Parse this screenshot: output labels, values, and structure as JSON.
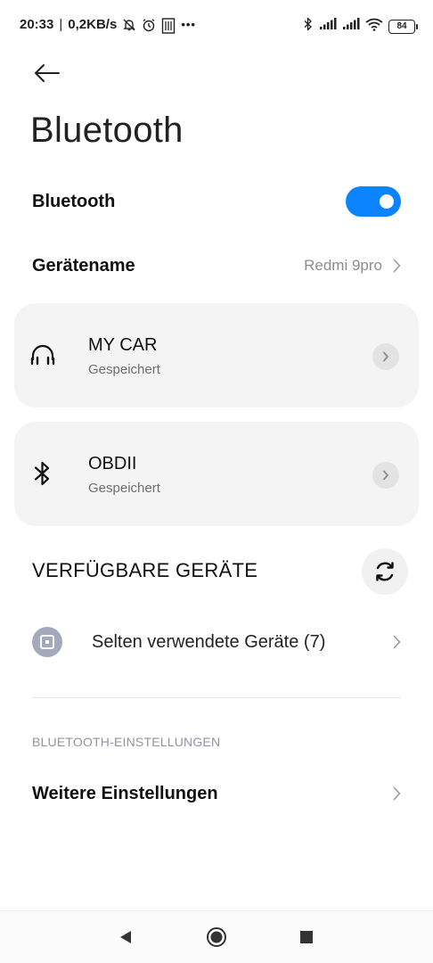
{
  "status_bar": {
    "time": "20:33",
    "separator": "|",
    "speed": "0,2KB/s",
    "more": "•••",
    "battery": "84",
    "icons_left": [
      "bell-off-icon",
      "alarm-icon",
      "sim-icon"
    ],
    "icons_right": [
      "bluetooth-icon",
      "signal-icon",
      "signal-icon",
      "wifi-icon",
      "battery-icon"
    ]
  },
  "header": {
    "title": "Bluetooth",
    "back_icon": "arrow-left-icon"
  },
  "bluetooth_row": {
    "label": "Bluetooth",
    "enabled": true,
    "accent_color": "#0d84ff"
  },
  "device_name_row": {
    "label": "Gerätename",
    "value": "Redmi 9pro"
  },
  "saved_devices": [
    {
      "name": "MY CAR",
      "status": "Gespeichert",
      "icon": "headphones-icon"
    },
    {
      "name": "OBDII",
      "status": "Gespeichert",
      "icon": "bluetooth-icon"
    }
  ],
  "available_section": {
    "title": "VERFÜGBARE GERÄTE",
    "refresh_icon": "refresh-icon"
  },
  "rare_devices": {
    "label": "Selten verwendete Geräte (7)",
    "icon": "device-icon"
  },
  "settings_section": {
    "caption": "BLUETOOTH-EINSTELLUNGEN",
    "more_label": "Weitere Einstellungen"
  },
  "nav_bar": {
    "icons": [
      "back-triangle-icon",
      "home-circle-icon",
      "recents-square-icon"
    ]
  }
}
